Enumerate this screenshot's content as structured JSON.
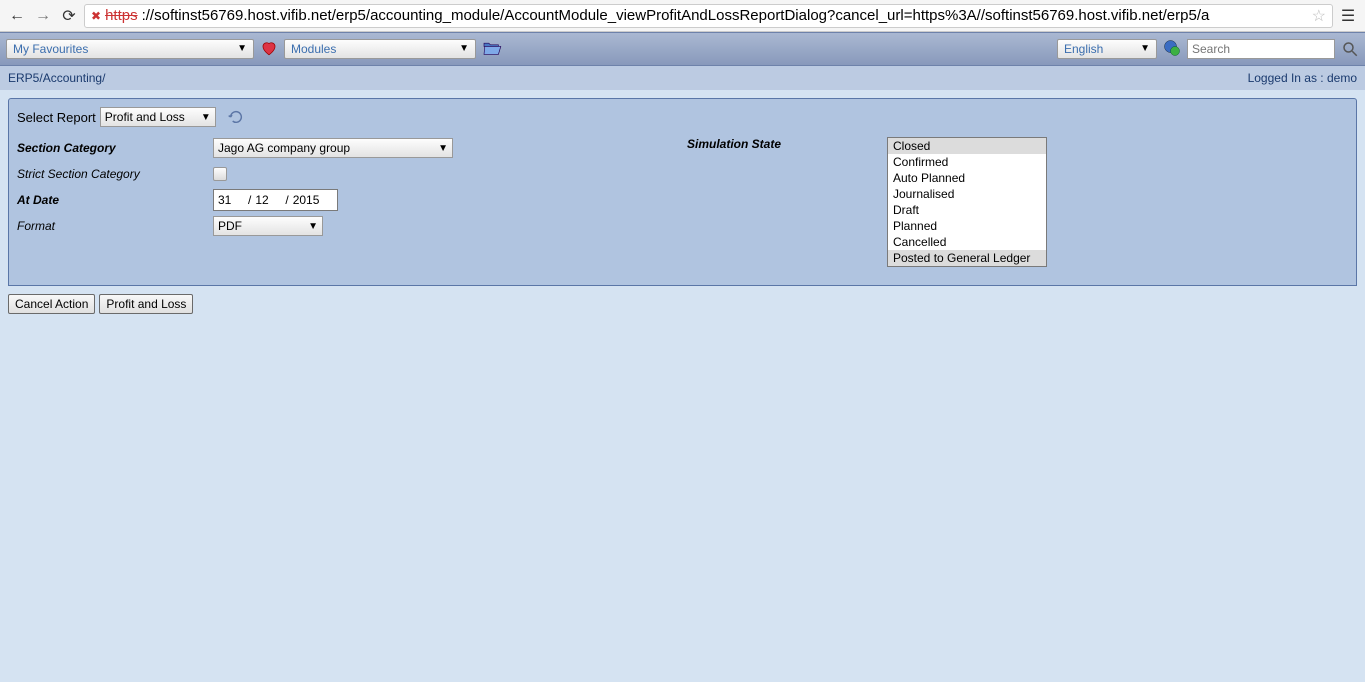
{
  "browser": {
    "url_https": "https",
    "url_rest": "://softinst56769.host.vifib.net/erp5/accounting_module/AccountModule_viewProfitAndLossReportDialog?cancel_url=https%3A//softinst56769.host.vifib.net/erp5/a"
  },
  "toolbar": {
    "favourites": "My Favourites",
    "modules": "Modules",
    "language": "English",
    "search_placeholder": "Search"
  },
  "breadcrumb": {
    "erp5": "ERP5",
    "accounting": "Accounting",
    "sep": " / ",
    "logged_in": "Logged In as : demo"
  },
  "form": {
    "select_report_label": "Select Report",
    "select_report_value": "Profit and Loss",
    "labels": {
      "section_category": "Section Category",
      "strict_section": "Strict Section Category",
      "at_date": "At Date",
      "format": "Format",
      "simulation_state": "Simulation State"
    },
    "section_category_value": "Jago AG company group",
    "date": {
      "day": "31",
      "month": "12",
      "year": "2015"
    },
    "format_value": "PDF",
    "simulation_states": [
      "Closed",
      "Confirmed",
      "Auto Planned",
      "Journalised",
      "Draft",
      "Planned",
      "Cancelled",
      "Posted to General Ledger"
    ],
    "simulation_selected": [
      0,
      7
    ]
  },
  "buttons": {
    "cancel": "Cancel Action",
    "submit": "Profit and Loss"
  }
}
